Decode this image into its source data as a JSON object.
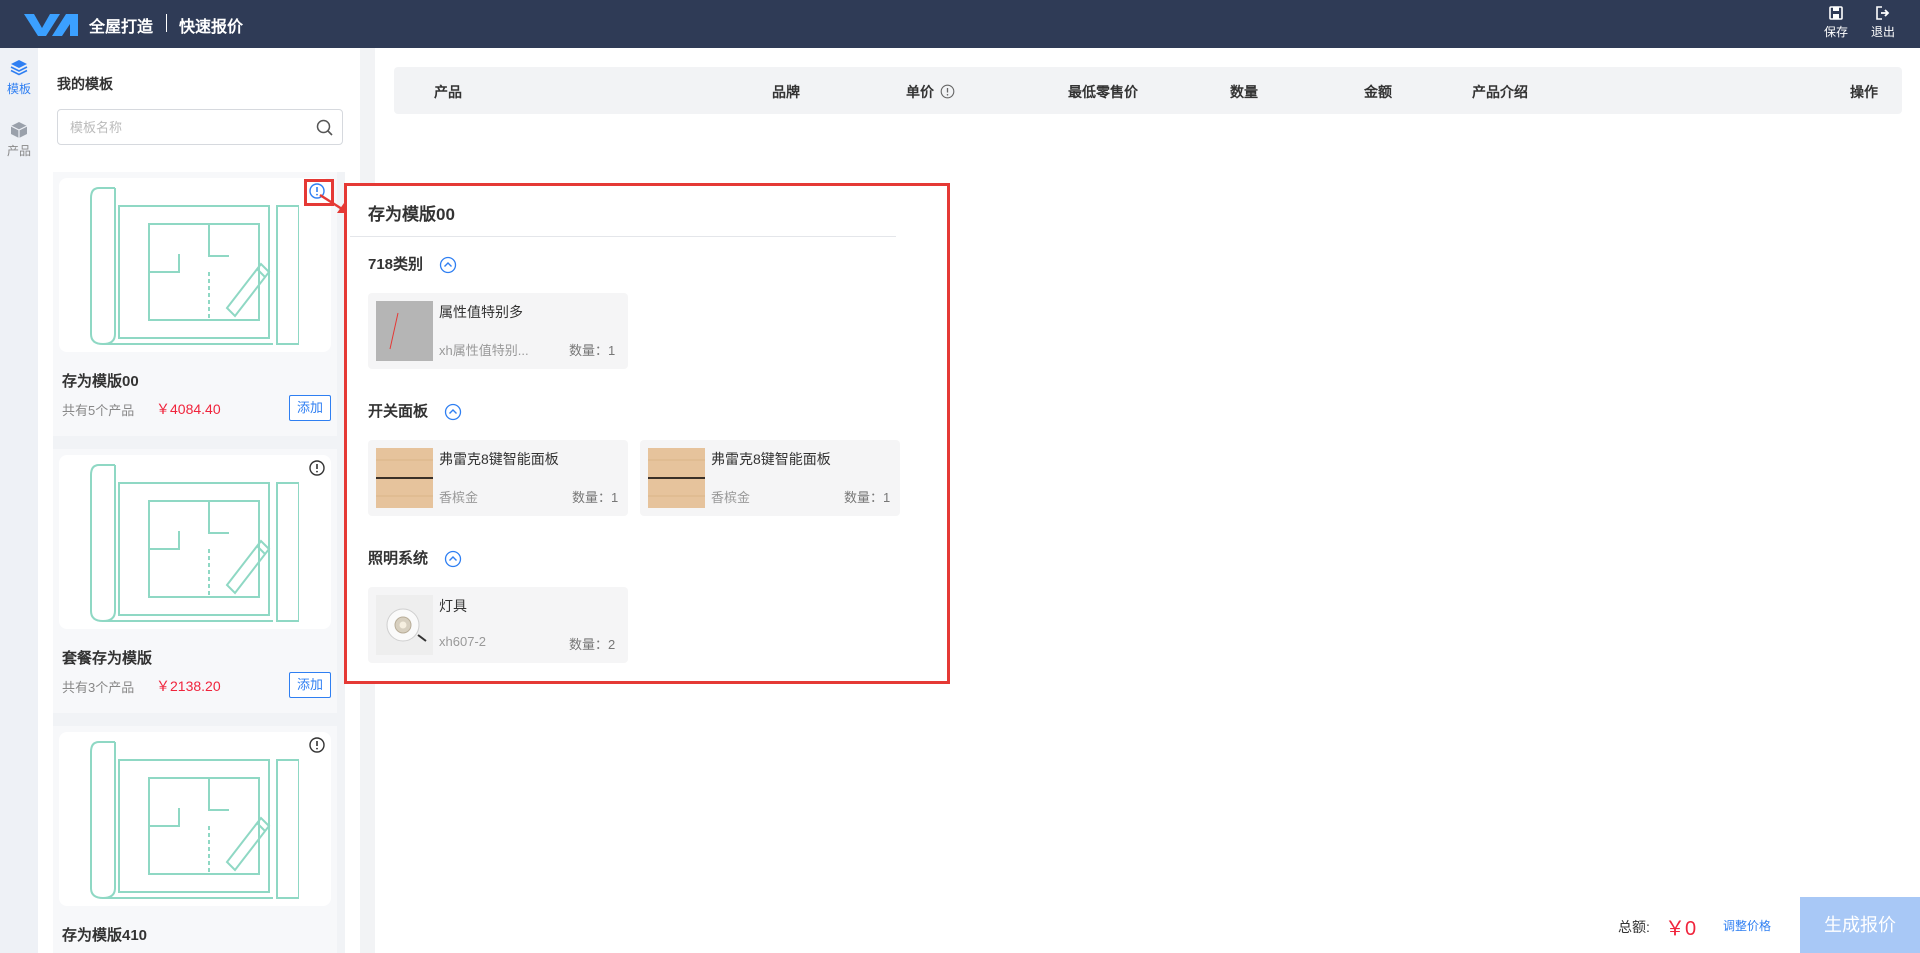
{
  "header": {
    "app_title": "全屋打造",
    "page_title": "快速报价",
    "save_label": "保存",
    "exit_label": "退出"
  },
  "rail": {
    "items": [
      {
        "label": "模板",
        "icon": "layers-icon"
      },
      {
        "label": "产品",
        "icon": "cube-icon"
      }
    ]
  },
  "templates": {
    "heading": "我的模板",
    "search_placeholder": "模板名称",
    "search_value": "",
    "items": [
      {
        "name": "存为模版00",
        "count": "共有5个产品",
        "price": "￥4084.40",
        "add_label": "添加"
      },
      {
        "name": "套餐存为模版",
        "count": "共有3个产品",
        "price": "￥2138.20",
        "add_label": "添加"
      },
      {
        "name": "存为模版410"
      }
    ]
  },
  "table": {
    "headers": [
      "产品",
      "品牌",
      "单价",
      "最低零售价",
      "数量",
      "金额",
      "产品介绍",
      "操作"
    ]
  },
  "footer": {
    "total_label": "总额:",
    "total_value": "￥0",
    "adjust_label": "调整价格",
    "generate_label": "生成报价"
  },
  "popover": {
    "title": "存为模版00",
    "groups": [
      {
        "label": "718类别",
        "products": [
          {
            "name": "属性值特别多",
            "desc": "xh属性值特别...",
            "qty": "数量：1"
          }
        ]
      },
      {
        "label": "开关面板",
        "products": [
          {
            "name": "弗雷克8键智能面板",
            "desc": "香槟金",
            "qty": "数量：1"
          },
          {
            "name": "弗雷克8键智能面板",
            "desc": "香槟金",
            "qty": "数量：1"
          }
        ]
      },
      {
        "label": "照明系统",
        "products": [
          {
            "name": "灯具",
            "desc": "xh607-2",
            "qty": "数量：2"
          }
        ]
      }
    ]
  },
  "colors": {
    "header_bg": "#2f3b56",
    "accent": "#2f7ff2",
    "price": "#f0243c",
    "highlight": "#e53935",
    "blueprint": "#8fd8c4"
  }
}
